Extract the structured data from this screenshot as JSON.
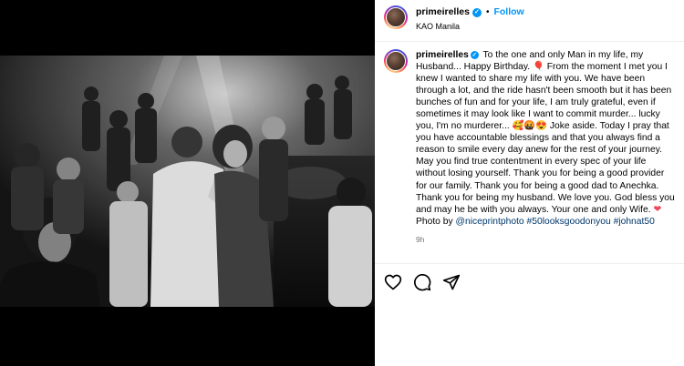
{
  "post": {
    "username": "primeirelles",
    "follow_label": "Follow",
    "location": "KAO Manila",
    "caption_username": "primeirelles",
    "caption_segments": [
      {
        "type": "text",
        "text": " To the one and only Man in my life, my Husband... Happy Birthday. "
      },
      {
        "type": "emoji",
        "text": "🎈"
      },
      {
        "type": "text",
        "text": " From the moment I met you I knew I wanted to share my life with you. We have been through a lot, and the ride hasn't been smooth but it has been bunches of fun and for your life, I am truly grateful, even if sometimes it may look like I want to commit murder... lucky you, I'm no murderer... "
      },
      {
        "type": "emoji",
        "text": "🥰🤬😍"
      },
      {
        "type": "text",
        "text": " Joke aside. Today I pray that you have accountable blessings and that you always find a reason to smile every day anew for the rest of your journey. May you find true contentment in every spec of your life without losing yourself. Thank you for being a good provider for our family. Thank you for being a good dad to Anechka. Thank you for being my husband. We love you. God bless you and may he be with you always. Your one and only Wife. "
      },
      {
        "type": "heart",
        "text": "❤"
      },
      {
        "type": "text",
        "text": " Photo by "
      },
      {
        "type": "mention",
        "text": "@niceprintphoto"
      },
      {
        "type": "text",
        "text": " "
      },
      {
        "type": "tag",
        "text": "#50looksgoodonyou"
      },
      {
        "type": "text",
        "text": " "
      },
      {
        "type": "tag",
        "text": "#johnat50"
      }
    ],
    "timestamp": "9h"
  },
  "icons": {
    "verified": "verified-badge-icon",
    "like": "heart-outline-icon",
    "comment": "comment-bubble-icon",
    "share": "paper-plane-icon"
  },
  "colors": {
    "accent": "#0095f6",
    "link": "#00376b",
    "heart": "#ed4956",
    "muted": "#737373"
  }
}
